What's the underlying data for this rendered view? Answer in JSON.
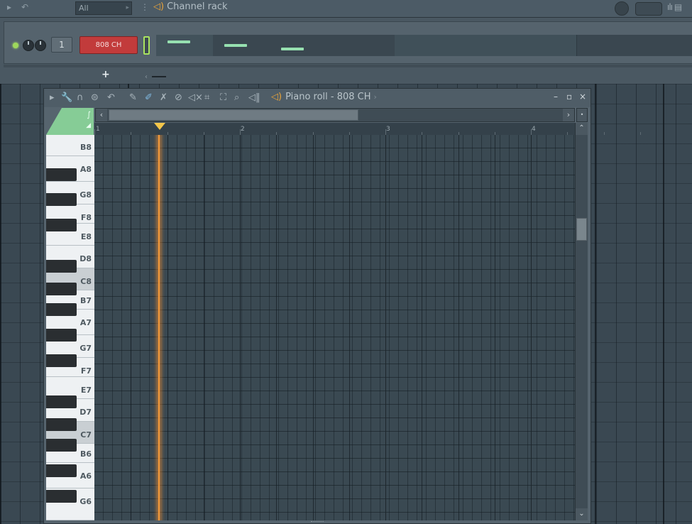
{
  "channel_rack": {
    "filter": "All",
    "title": "Channel rack",
    "channel_number": "1",
    "channel_name": "808 CH",
    "add_label": "+"
  },
  "piano_roll": {
    "title": "Piano roll - 808 CH",
    "ruler_numbers": [
      "1",
      "2",
      "3",
      "4"
    ],
    "key_labels": [
      "B8",
      "A8",
      "G8",
      "F8",
      "E8",
      "D8",
      "C8",
      "B7",
      "A7",
      "G7",
      "F7",
      "E7",
      "D7",
      "C7",
      "B6",
      "A6",
      "G6"
    ],
    "window_controls": [
      "–",
      "▫",
      "×"
    ]
  },
  "colors": {
    "accent_green": "#86cc96",
    "channel_red": "#c23b3b",
    "playhead_orange": "#f39a3a",
    "speaker_orange": "#e8a33a"
  },
  "icons": {
    "rack_toolbar": [
      "play-arrow-icon",
      "undo-icon",
      "options-icon",
      "speaker-icon",
      "bar-meter-icon"
    ],
    "piano_roll_toolbar": [
      "menu-arrow-icon",
      "wrench-icon",
      "magnet-icon",
      "stamp-icon",
      "undo-icon",
      "pencil-icon",
      "paint-brush-icon",
      "delete-icon",
      "mute-icon",
      "slice-icon",
      "select-icon",
      "zoom-icon",
      "playback-icon"
    ]
  }
}
